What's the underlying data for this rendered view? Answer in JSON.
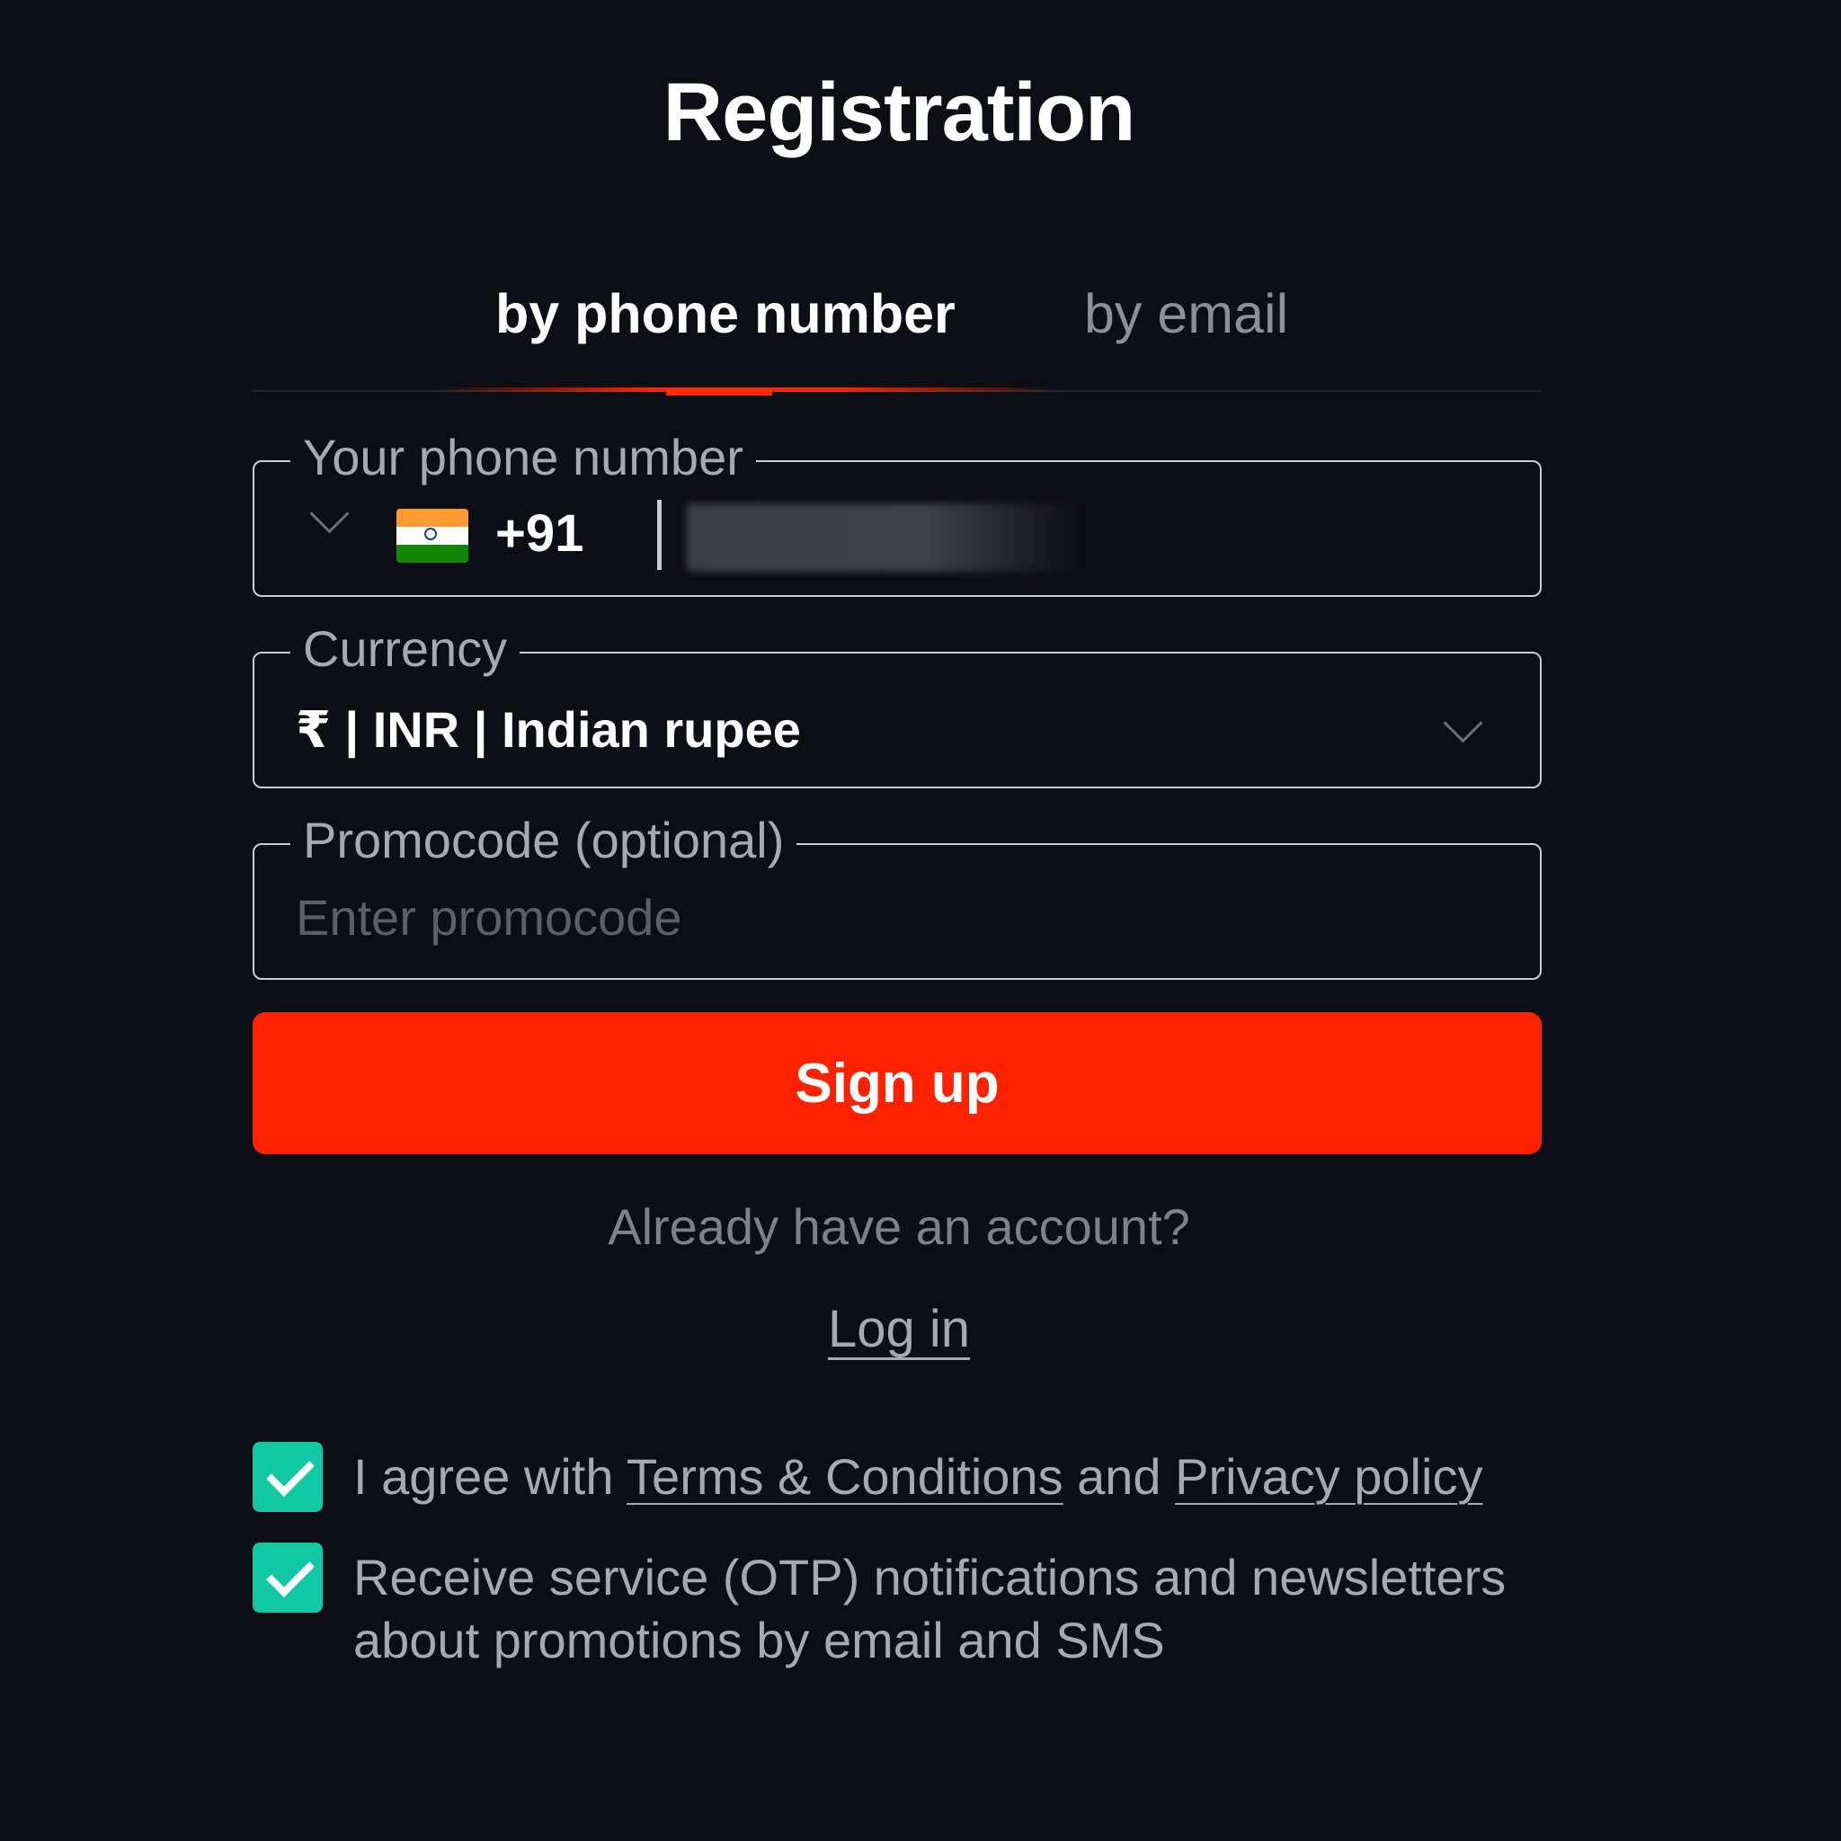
{
  "title": "Registration",
  "tabs": {
    "phone": "by phone number",
    "email": "by email",
    "active": "phone"
  },
  "phone_field": {
    "legend": "Your phone number",
    "country_flag": "india-flag",
    "dial_code": "+91",
    "value": ""
  },
  "currency_field": {
    "legend": "Currency",
    "value": "₹ | INR | Indian rupee"
  },
  "promo_field": {
    "legend": "Promocode (optional)",
    "placeholder": "Enter promocode",
    "value": ""
  },
  "signup_label": "Sign up",
  "already_text": "Already have an account?",
  "login_label": "Log in",
  "agreements": {
    "terms": {
      "checked": true,
      "prefix": "I agree with ",
      "terms_link": "Terms & Conditions",
      "middle": " and ",
      "privacy_link": "Privacy policy"
    },
    "notifications": {
      "checked": true,
      "text": "Receive service (OTP) notifications and newsletters about promotions by email and SMS"
    }
  },
  "colors": {
    "background": "#0c0f15",
    "accent": "#ff2200",
    "checkbox": "#11c8a4",
    "text_primary": "#ffffff",
    "text_muted": "#a5a9b1"
  }
}
